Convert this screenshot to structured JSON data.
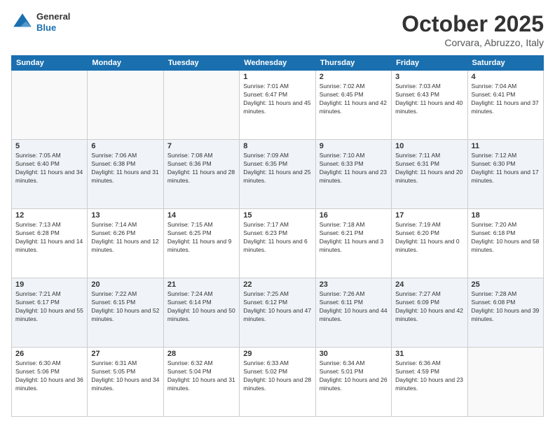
{
  "header": {
    "logo_general": "General",
    "logo_blue": "Blue",
    "month": "October 2025",
    "location": "Corvara, Abruzzo, Italy"
  },
  "days_of_week": [
    "Sunday",
    "Monday",
    "Tuesday",
    "Wednesday",
    "Thursday",
    "Friday",
    "Saturday"
  ],
  "weeks": [
    [
      {
        "num": "",
        "info": ""
      },
      {
        "num": "",
        "info": ""
      },
      {
        "num": "",
        "info": ""
      },
      {
        "num": "1",
        "info": "Sunrise: 7:01 AM\nSunset: 6:47 PM\nDaylight: 11 hours and 45 minutes."
      },
      {
        "num": "2",
        "info": "Sunrise: 7:02 AM\nSunset: 6:45 PM\nDaylight: 11 hours and 42 minutes."
      },
      {
        "num": "3",
        "info": "Sunrise: 7:03 AM\nSunset: 6:43 PM\nDaylight: 11 hours and 40 minutes."
      },
      {
        "num": "4",
        "info": "Sunrise: 7:04 AM\nSunset: 6:41 PM\nDaylight: 11 hours and 37 minutes."
      }
    ],
    [
      {
        "num": "5",
        "info": "Sunrise: 7:05 AM\nSunset: 6:40 PM\nDaylight: 11 hours and 34 minutes."
      },
      {
        "num": "6",
        "info": "Sunrise: 7:06 AM\nSunset: 6:38 PM\nDaylight: 11 hours and 31 minutes."
      },
      {
        "num": "7",
        "info": "Sunrise: 7:08 AM\nSunset: 6:36 PM\nDaylight: 11 hours and 28 minutes."
      },
      {
        "num": "8",
        "info": "Sunrise: 7:09 AM\nSunset: 6:35 PM\nDaylight: 11 hours and 25 minutes."
      },
      {
        "num": "9",
        "info": "Sunrise: 7:10 AM\nSunset: 6:33 PM\nDaylight: 11 hours and 23 minutes."
      },
      {
        "num": "10",
        "info": "Sunrise: 7:11 AM\nSunset: 6:31 PM\nDaylight: 11 hours and 20 minutes."
      },
      {
        "num": "11",
        "info": "Sunrise: 7:12 AM\nSunset: 6:30 PM\nDaylight: 11 hours and 17 minutes."
      }
    ],
    [
      {
        "num": "12",
        "info": "Sunrise: 7:13 AM\nSunset: 6:28 PM\nDaylight: 11 hours and 14 minutes."
      },
      {
        "num": "13",
        "info": "Sunrise: 7:14 AM\nSunset: 6:26 PM\nDaylight: 11 hours and 12 minutes."
      },
      {
        "num": "14",
        "info": "Sunrise: 7:15 AM\nSunset: 6:25 PM\nDaylight: 11 hours and 9 minutes."
      },
      {
        "num": "15",
        "info": "Sunrise: 7:17 AM\nSunset: 6:23 PM\nDaylight: 11 hours and 6 minutes."
      },
      {
        "num": "16",
        "info": "Sunrise: 7:18 AM\nSunset: 6:21 PM\nDaylight: 11 hours and 3 minutes."
      },
      {
        "num": "17",
        "info": "Sunrise: 7:19 AM\nSunset: 6:20 PM\nDaylight: 11 hours and 0 minutes."
      },
      {
        "num": "18",
        "info": "Sunrise: 7:20 AM\nSunset: 6:18 PM\nDaylight: 10 hours and 58 minutes."
      }
    ],
    [
      {
        "num": "19",
        "info": "Sunrise: 7:21 AM\nSunset: 6:17 PM\nDaylight: 10 hours and 55 minutes."
      },
      {
        "num": "20",
        "info": "Sunrise: 7:22 AM\nSunset: 6:15 PM\nDaylight: 10 hours and 52 minutes."
      },
      {
        "num": "21",
        "info": "Sunrise: 7:24 AM\nSunset: 6:14 PM\nDaylight: 10 hours and 50 minutes."
      },
      {
        "num": "22",
        "info": "Sunrise: 7:25 AM\nSunset: 6:12 PM\nDaylight: 10 hours and 47 minutes."
      },
      {
        "num": "23",
        "info": "Sunrise: 7:26 AM\nSunset: 6:11 PM\nDaylight: 10 hours and 44 minutes."
      },
      {
        "num": "24",
        "info": "Sunrise: 7:27 AM\nSunset: 6:09 PM\nDaylight: 10 hours and 42 minutes."
      },
      {
        "num": "25",
        "info": "Sunrise: 7:28 AM\nSunset: 6:08 PM\nDaylight: 10 hours and 39 minutes."
      }
    ],
    [
      {
        "num": "26",
        "info": "Sunrise: 6:30 AM\nSunset: 5:06 PM\nDaylight: 10 hours and 36 minutes."
      },
      {
        "num": "27",
        "info": "Sunrise: 6:31 AM\nSunset: 5:05 PM\nDaylight: 10 hours and 34 minutes."
      },
      {
        "num": "28",
        "info": "Sunrise: 6:32 AM\nSunset: 5:04 PM\nDaylight: 10 hours and 31 minutes."
      },
      {
        "num": "29",
        "info": "Sunrise: 6:33 AM\nSunset: 5:02 PM\nDaylight: 10 hours and 28 minutes."
      },
      {
        "num": "30",
        "info": "Sunrise: 6:34 AM\nSunset: 5:01 PM\nDaylight: 10 hours and 26 minutes."
      },
      {
        "num": "31",
        "info": "Sunrise: 6:36 AM\nSunset: 4:59 PM\nDaylight: 10 hours and 23 minutes."
      },
      {
        "num": "",
        "info": ""
      }
    ]
  ]
}
